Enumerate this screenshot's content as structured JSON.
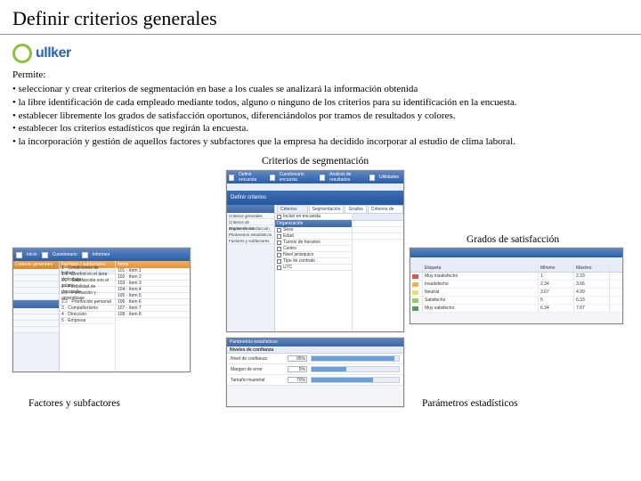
{
  "page_title": "Definir criterios generales",
  "logo_text": "ullker",
  "permite": {
    "head": "Permite:",
    "items": [
      "seleccionar y crear criterios de segmentación en base a los cuales se analizará la información obtenida",
      "la libre identificación de cada empleado mediante todos, alguno o ninguno de los criterios para su identificación en la encuesta.",
      "establecer libremente los grados de satisfacción oportunos, diferenciándolos por tramos de resultados y colores.",
      "establecer los criterios estadísticos que regirán la encuesta.",
      "la incorporación y gestión de aquellos factores y subfactores que la empresa ha decidido incorporar al estudio de clima laboral."
    ]
  },
  "captions": {
    "criteria": "Criterios de segmentación",
    "grades": "Grados de satisfacción",
    "factors": "Factores y subfactores",
    "params": "Parámetros estadísticos"
  },
  "shot_factors": {
    "top_tabs": [
      "Inicio",
      "Cuestionario",
      "Informes"
    ],
    "sidebar_head": "Criterios generales",
    "left_head": "Factores / subfactores",
    "right_head": "Ítems",
    "factors": [
      "1 · Condiciones de trabajo",
      "  1.1 · Confort en el área de trabajo",
      "  1.2 · Satisfacción con el salario",
      "2 · Posibilidad de desarrollo",
      "  2.1 · Formación y aprendizaje",
      "  2.2 · Promoción personal",
      "3 · Compañerismo",
      "4 · Dirección",
      "5 · Empresa"
    ],
    "items": [
      "101 · ítem 1",
      "102 · ítem 2",
      "103 · ítem 3",
      "104 · ítem 4",
      "105 · ítem 5",
      "106 · ítem 6",
      "107 · ítem 7",
      "108 · ítem 8"
    ]
  },
  "shot_criteria": {
    "top_tabs": [
      "Definir encuesta",
      "Cuestionario encuesta",
      "Análisis de resultados",
      "Utilidades"
    ],
    "band2_label": "Definir criterios",
    "side_items": [
      "Criterios generales",
      "Criterios de segmentación",
      "Grados de satisfacción",
      "Parámetros estadísticos",
      "Factores y subfactores"
    ],
    "tabs": [
      "Criterios generales",
      "Segmentación",
      "Grados",
      "Criterios de asignación"
    ],
    "check_label": "Incluir en encuesta",
    "sect_label": "Organización",
    "criteria_items": [
      "Sexo",
      "Edad",
      "Turnos de horarios",
      "Centro",
      "Nivel jerárquico",
      "Tipo de contrato",
      "UTC"
    ]
  },
  "shot_params": {
    "section": "Parámetros estadísticos",
    "subsection": "Niveles de confianza",
    "rows": [
      {
        "label": "Nivel de confianza",
        "value": "95%",
        "pct": 95
      },
      {
        "label": "Margen de error",
        "value": "5%",
        "pct": 40
      },
      {
        "label": "Tamaño muestral",
        "value": "70%",
        "pct": 70
      }
    ]
  },
  "shot_grades": {
    "columns": [
      "",
      "Etiqueta",
      "Mínimo",
      "Máximo"
    ],
    "rows": [
      {
        "color": "#d9534f",
        "label": "Muy insatisfecho",
        "min": "1",
        "max": "2.33"
      },
      {
        "color": "#f0b04a",
        "label": "Insatisfecho",
        "min": "2.34",
        "max": "3.66"
      },
      {
        "color": "#f4df5a",
        "label": "Neutral",
        "min": "3.67",
        "max": "4.99"
      },
      {
        "color": "#8fce5a",
        "label": "Satisfecho",
        "min": "5",
        "max": "6.33"
      },
      {
        "color": "#4aa158",
        "label": "Muy satisfecho",
        "min": "6.34",
        "max": "7.67"
      }
    ]
  }
}
